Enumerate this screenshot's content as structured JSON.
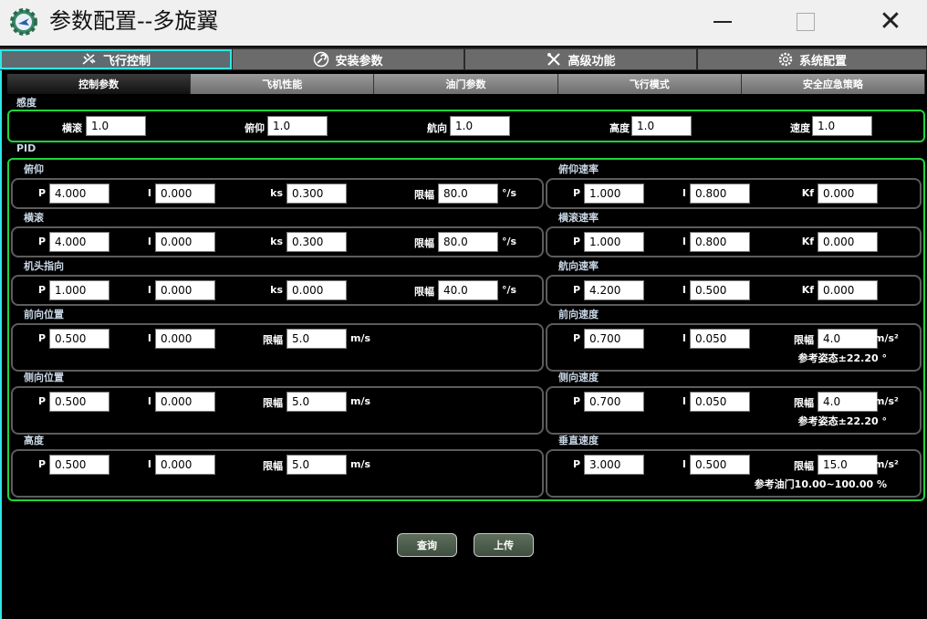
{
  "window": {
    "title": "参数配置--多旋翼"
  },
  "main_tabs": [
    {
      "label": "飞行控制",
      "icon": "plane-icon"
    },
    {
      "label": "安装参数",
      "icon": "wrench-icon"
    },
    {
      "label": "高级功能",
      "icon": "tools-icon"
    },
    {
      "label": "系统配置",
      "icon": "gear-icon"
    }
  ],
  "sub_tabs": [
    "控制参数",
    "飞机性能",
    "油门参数",
    "飞行模式",
    "安全应急策略"
  ],
  "sensitivity": {
    "title": "感度",
    "fields": [
      {
        "label": "横滚",
        "value": "1.0"
      },
      {
        "label": "俯仰",
        "value": "1.0"
      },
      {
        "label": "航向",
        "value": "1.0"
      },
      {
        "label": "高度",
        "value": "1.0"
      },
      {
        "label": "速度",
        "value": "1.0"
      }
    ]
  },
  "pid": {
    "title": "PID",
    "sections": [
      {
        "name": "俯仰",
        "fields": [
          {
            "label": "P",
            "value": "4.000"
          },
          {
            "label": "I",
            "value": "0.000"
          },
          {
            "label": "ks",
            "value": "0.300"
          },
          {
            "label": "限幅",
            "value": "80.0"
          }
        ],
        "unit": "°/s"
      },
      {
        "name": "俯仰速率",
        "fields": [
          {
            "label": "P",
            "value": "1.000"
          },
          {
            "label": "I",
            "value": "0.800"
          },
          {
            "label": "Kf",
            "value": "0.000"
          }
        ]
      },
      {
        "name": "横滚",
        "fields": [
          {
            "label": "P",
            "value": "4.000"
          },
          {
            "label": "I",
            "value": "0.000"
          },
          {
            "label": "ks",
            "value": "0.300"
          },
          {
            "label": "限幅",
            "value": "80.0"
          }
        ],
        "unit": "°/s"
      },
      {
        "name": "横滚速率",
        "fields": [
          {
            "label": "P",
            "value": "1.000"
          },
          {
            "label": "I",
            "value": "0.800"
          },
          {
            "label": "Kf",
            "value": "0.000"
          }
        ]
      },
      {
        "name": "机头指向",
        "fields": [
          {
            "label": "P",
            "value": "1.000"
          },
          {
            "label": "I",
            "value": "0.000"
          },
          {
            "label": "ks",
            "value": "0.000"
          },
          {
            "label": "限幅",
            "value": "40.0"
          }
        ],
        "unit": "°/s"
      },
      {
        "name": "航向速率",
        "fields": [
          {
            "label": "P",
            "value": "4.200"
          },
          {
            "label": "I",
            "value": "0.500"
          },
          {
            "label": "Kf",
            "value": "0.000"
          }
        ]
      },
      {
        "name": "前向位置",
        "fields": [
          {
            "label": "P",
            "value": "0.500"
          },
          {
            "label": "I",
            "value": "0.000"
          },
          {
            "label": "限幅",
            "value": "5.0"
          }
        ],
        "unit": "m/s"
      },
      {
        "name": "前向速度",
        "fields": [
          {
            "label": "P",
            "value": "0.700"
          },
          {
            "label": "I",
            "value": "0.050"
          },
          {
            "label": "限幅",
            "value": "4.0"
          }
        ],
        "unit": "m/s²",
        "note": "参考姿态±22.20 °"
      },
      {
        "name": "侧向位置",
        "fields": [
          {
            "label": "P",
            "value": "0.500"
          },
          {
            "label": "I",
            "value": "0.000"
          },
          {
            "label": "限幅",
            "value": "5.0"
          }
        ],
        "unit": "m/s"
      },
      {
        "name": "侧向速度",
        "fields": [
          {
            "label": "P",
            "value": "0.700"
          },
          {
            "label": "I",
            "value": "0.050"
          },
          {
            "label": "限幅",
            "value": "4.0"
          }
        ],
        "unit": "m/s²",
        "note": "参考姿态±22.20 °"
      },
      {
        "name": "高度",
        "fields": [
          {
            "label": "P",
            "value": "0.500"
          },
          {
            "label": "I",
            "value": "0.000"
          },
          {
            "label": "限幅",
            "value": "5.0"
          }
        ],
        "unit": "m/s"
      },
      {
        "name": "垂直速度",
        "fields": [
          {
            "label": "P",
            "value": "3.000"
          },
          {
            "label": "I",
            "value": "0.500"
          },
          {
            "label": "限幅",
            "value": "15.0"
          }
        ],
        "unit": "m/s²",
        "note": "参考油门10.00~100.00 %"
      }
    ]
  },
  "buttons": {
    "query": "查询",
    "upload": "上传"
  },
  "colors": {
    "accent": "#2ee8e8",
    "group_border": "#1ed43a"
  }
}
